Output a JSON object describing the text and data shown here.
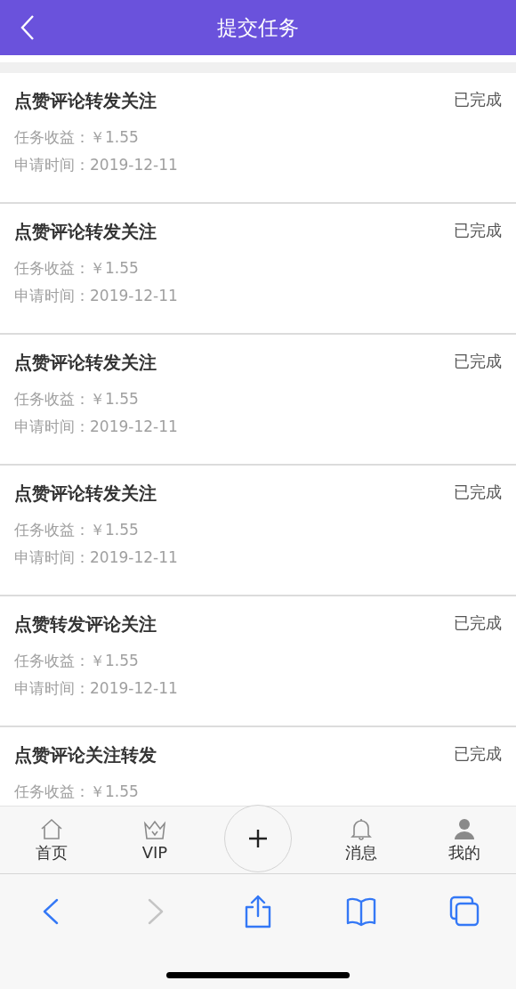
{
  "header": {
    "title": "提交任务"
  },
  "tasks": [
    {
      "title": "点赞评论转发关注",
      "status": "已完成",
      "income": "任务收益：￥1.55",
      "date": "申请时间：2019-12-11"
    },
    {
      "title": "点赞评论转发关注",
      "status": "已完成",
      "income": "任务收益：￥1.55",
      "date": "申请时间：2019-12-11"
    },
    {
      "title": "点赞评论转发关注",
      "status": "已完成",
      "income": "任务收益：￥1.55",
      "date": "申请时间：2019-12-11"
    },
    {
      "title": "点赞评论转发关注",
      "status": "已完成",
      "income": "任务收益：￥1.55",
      "date": "申请时间：2019-12-11"
    },
    {
      "title": "点赞转发评论关注",
      "status": "已完成",
      "income": "任务收益：￥1.55",
      "date": "申请时间：2019-12-11"
    },
    {
      "title": "点赞评论关注转发",
      "status": "已完成",
      "income": "任务收益：￥1.55"
    }
  ],
  "tab_bar": [
    {
      "kind": "home",
      "label": "首页"
    },
    {
      "kind": "vip",
      "label": "VIP"
    },
    {
      "kind": "add"
    },
    {
      "kind": "bell",
      "label": "消息"
    },
    {
      "kind": "person",
      "label": "我的"
    }
  ],
  "browser_toolbar": [
    {
      "kind": "back",
      "disabled": false
    },
    {
      "kind": "forward",
      "disabled": true
    },
    {
      "kind": "share",
      "disabled": false
    },
    {
      "kind": "bookmarks",
      "disabled": false
    },
    {
      "kind": "tabs",
      "disabled": false
    }
  ]
}
